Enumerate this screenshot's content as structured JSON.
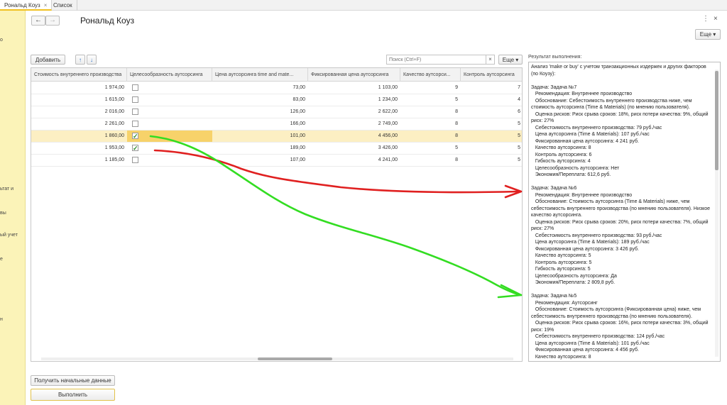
{
  "tabs": [
    {
      "label": "Рональд Коуз",
      "close": "×"
    },
    {
      "label": "Список"
    }
  ],
  "sidebar_fragments": [
    "о",
    "ьтат и",
    "вы",
    "ый учет",
    "е",
    "н"
  ],
  "nav": {
    "back": "←",
    "forward": "→"
  },
  "title": "Рональд Коуз",
  "header_icons": {
    "menu": "⋮",
    "close": "×"
  },
  "more_label": "Еще ▾",
  "toolbar": {
    "add_label": "Добавить",
    "up": "↑",
    "down": "↓",
    "search_placeholder": "Поиск (Ctrl+F)",
    "search_clear": "×",
    "more_label": "Еще ▾"
  },
  "table": {
    "columns": [
      "Стоимость внутреннего производства",
      "Целесообразность аутсорсинга",
      "Цена аутсорсинга time and mate...",
      "Фиксированная цена аутсорсинга",
      "Качество аутсорси...",
      "Контроль аутсорсинга"
    ],
    "rows": [
      {
        "cost": "1 974,00",
        "checked": false,
        "price": "73,00",
        "fixed": "1 103,00",
        "quality": "9",
        "control": "7"
      },
      {
        "cost": "1 615,00",
        "checked": false,
        "price": "83,00",
        "fixed": "1 234,00",
        "quality": "5",
        "control": "4"
      },
      {
        "cost": "2 016,00",
        "checked": false,
        "price": "126,00",
        "fixed": "2 622,00",
        "quality": "8",
        "control": "6"
      },
      {
        "cost": "2 261,00",
        "checked": false,
        "price": "166,00",
        "fixed": "2 749,00",
        "quality": "8",
        "control": "5"
      },
      {
        "cost": "1 860,00",
        "checked": true,
        "price": "101,00",
        "fixed": "4 456,00",
        "quality": "8",
        "control": "5"
      },
      {
        "cost": "1 953,00",
        "checked": true,
        "price": "189,00",
        "fixed": "3 426,00",
        "quality": "5",
        "control": "5"
      },
      {
        "cost": "1 185,00",
        "checked": false,
        "price": "107,00",
        "fixed": "4 241,00",
        "quality": "8",
        "control": "5"
      }
    ],
    "check_mark": "✓",
    "selected_row_index": 4
  },
  "result": {
    "label": "Результат выполнения:",
    "text": "Анализ 'make or buy' с учетом транзакционных издержек и других факторов (по Коузу):\n\nЗадача: Задача №7\n   Рекомендация: Внутреннее производство\n   Обоснование: Себестоимость внутреннего производства ниже, чем стоимость аутсорсинга (Time & Materials) (по мнению пользователя).\n   Оценка рисков: Риск срыва сроков: 18%, риск потери качества: 9%, общий риск: 27%\n   Себестоимость внутреннего производства: 79 руб./час\n   Цена аутсорсинга (Time & Materials): 107 руб./час\n   Фиксированная цена аутсорсинга: 4 241 руб.\n   Качество аутсорсинга: 8\n   Контроль аутсорсинга: 6\n   Гибкость аутсорсинга: 4\n   Целесообразность аутсорсинга: Нет\n   Экономия/Переплата: 612,6 руб.\n\nЗадача: Задача №6\n   Рекомендация: Внутреннее производство\n   Обоснование: Стоимость аутсорсинга (Time & Materials) ниже, чем себестоимость внутреннего производства (по мнению пользователя). Низкое качество аутсорсинга.\n   Оценка рисков: Риск срыва сроков: 20%, риск потери качества: 7%, общий риск: 27%\n   Себестоимость внутреннего производства: 93 руб./час\n   Цена аутсорсинга (Time & Materials): 189 руб./час\n   Фиксированная цена аутсорсинга: 3 426 руб.\n   Качество аутсорсинга: 5\n   Контроль аутсорсинга: 5\n   Гибкость аутсорсинга: 5\n   Целесообразность аутсорсинга: Да\n   Экономия/Переплата: 2 809,8 руб.\n\nЗадача: Задача №5\n   Рекомендация: Аутсорсинг\n   Обоснование: Стоимость аутсорсинга (Фиксированная цена) ниже, чем себестоимость внутреннего производства (по мнению пользователя).\n   Оценка рисков: Риск срыва сроков: 16%, риск потери качества: 3%, общий риск: 19%\n   Себестоимость внутреннего производства: 124 руб./час\n   Цена аутсорсинга (Time & Materials): 101 руб./час\n   Фиксированная цена аутсорсинга: 4 456 руб.\n   Качество аутсорсинга: 8\n   Контроль аутсорсинга: 5"
  },
  "footer": {
    "get_data_label": "Получить начальные данные",
    "run_label": "Выполнить"
  },
  "annotation_colors": {
    "red": "#e02020",
    "green": "#33dd22"
  }
}
